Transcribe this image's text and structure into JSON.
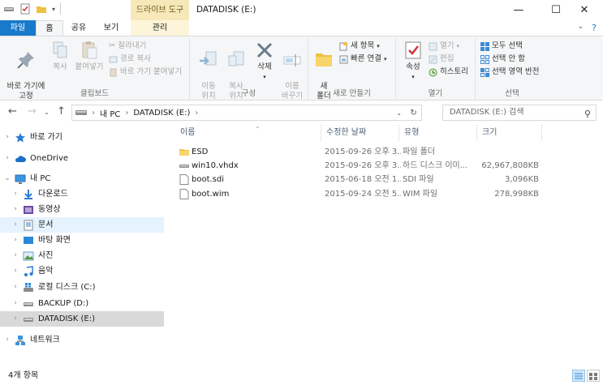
{
  "window": {
    "title": "DATADISK (E:)",
    "context_tab_header": "드라이브 도구",
    "buttons": {
      "minimize": "—",
      "maximize": "☐",
      "close": "✕"
    }
  },
  "tabs": {
    "file": "파일",
    "home": "홈",
    "share": "공유",
    "view": "보기",
    "manage": "관리",
    "help_icon": "?"
  },
  "ribbon": {
    "clipboard": {
      "label": "클립보드",
      "pin": "바로 가기에\n고정",
      "copy": "복사",
      "paste": "붙여넣기",
      "cut": "잘라내기",
      "copy_path": "경로 복사",
      "paste_shortcut": "바로 가기 붙여넣기"
    },
    "organize": {
      "label": "구성",
      "move_to": "이동\n위치",
      "copy_to": "복사\n위치",
      "delete": "삭제",
      "rename": "이름\n바꾸기"
    },
    "new": {
      "label": "새로 만들기",
      "new_folder": "새\n폴더",
      "new_item": "새 항목",
      "easy_access": "빠른 연결"
    },
    "open": {
      "label": "열기",
      "properties": "속성",
      "open": "열기",
      "edit": "편집",
      "history": "히스토리"
    },
    "select": {
      "label": "선택",
      "select_all": "모두 선택",
      "select_none": "선택 안 함",
      "invert": "선택 영역 반전"
    }
  },
  "address": {
    "path": [
      "내 PC",
      "DATADISK (E:)"
    ],
    "search_placeholder": "DATADISK (E:) 검색"
  },
  "nav_pane": {
    "items": [
      {
        "label": "바로 가기",
        "icon": "star-icon"
      },
      {
        "label": "OneDrive",
        "icon": "cloud-icon"
      },
      {
        "label": "내 PC",
        "icon": "computer-icon"
      },
      {
        "label": "다운로드",
        "icon": "downloads-icon"
      },
      {
        "label": "동영상",
        "icon": "videos-icon"
      },
      {
        "label": "문서",
        "icon": "documents-icon"
      },
      {
        "label": "바탕 화면",
        "icon": "desktop-icon"
      },
      {
        "label": "사진",
        "icon": "pictures-icon"
      },
      {
        "label": "음악",
        "icon": "music-icon"
      },
      {
        "label": "로컬 디스크 (C:)",
        "icon": "windows-drive-icon"
      },
      {
        "label": "BACKUP (D:)",
        "icon": "drive-icon"
      },
      {
        "label": "DATADISK (E:)",
        "icon": "drive-icon"
      },
      {
        "label": "네트워크",
        "icon": "network-icon"
      }
    ]
  },
  "columns": {
    "name": "이름",
    "date": "수정한 날짜",
    "type": "유형",
    "size": "크기"
  },
  "files": [
    {
      "name": "ESD",
      "date": "2015-09-26 오후 3...",
      "type": "파일 폴더",
      "size": "",
      "icon": "folder-icon"
    },
    {
      "name": "win10.vhdx",
      "date": "2015-09-26 오후 3...",
      "type": "하드 디스크 이미...",
      "size": "62,967,808KB",
      "icon": "vhd-icon"
    },
    {
      "name": "boot.sdi",
      "date": "2015-06-18 오전 1...",
      "type": "SDI 파일",
      "size": "3,096KB",
      "icon": "file-icon"
    },
    {
      "name": "boot.wim",
      "date": "2015-09-24 오전 5...",
      "type": "WIM 파일",
      "size": "278,998KB",
      "icon": "file-icon"
    }
  ],
  "status": {
    "count": "4개 항목"
  },
  "colors": {
    "accent": "#1979ca",
    "selection": "#cce8ff",
    "context_tab": "#f6e8b8"
  }
}
